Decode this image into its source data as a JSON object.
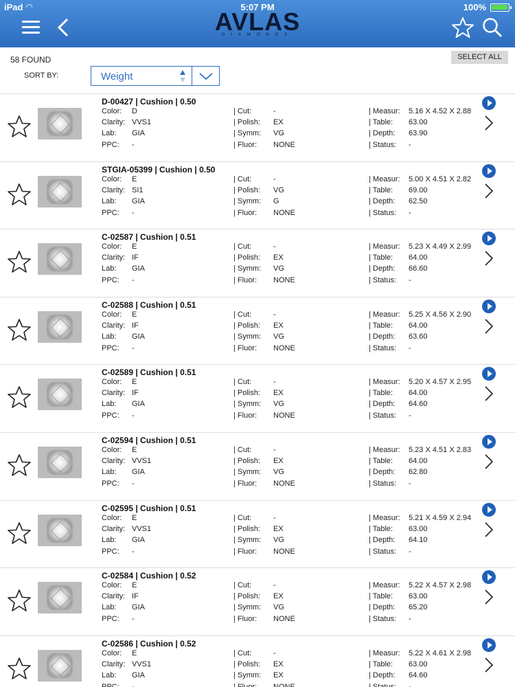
{
  "status": {
    "carrier": "iPad",
    "time": "5:07 PM",
    "battery": "100%",
    "battery_level": 1.0
  },
  "header": {
    "brand": "AVLAS",
    "brand_sub": "DIAMONDS"
  },
  "filters": {
    "found": "58 FOUND",
    "select_all": "SELECT ALL",
    "sort_label": "SORT BY:",
    "sort_value": "Weight"
  },
  "labels": {
    "color": "Color:",
    "clarity": "Clarity:",
    "lab": "Lab:",
    "ppc": "PPC:",
    "cut": "Cut:",
    "polish": "Polish:",
    "symm": "Symm:",
    "fluor": "Fluor:",
    "measur": "Measur:",
    "table": "Table:",
    "depth": "Depth:",
    "status": "Status:"
  },
  "items": [
    {
      "title": "D-00427  |  Cushion  |  0.50",
      "color": "D",
      "clarity": "VVS1",
      "lab": "GIA",
      "ppc": "-",
      "cut": "-",
      "polish": "EX",
      "symm": "VG",
      "fluor": "NONE",
      "measur": "5.16 X 4.52 X 2.88",
      "table": "63.00",
      "depth": "63.90",
      "status": "-"
    },
    {
      "title": "STGIA-05399  |  Cushion  |  0.50",
      "color": "E",
      "clarity": "SI1",
      "lab": "GIA",
      "ppc": "-",
      "cut": "-",
      "polish": "VG",
      "symm": "G",
      "fluor": "NONE",
      "measur": "5.00 X 4.51 X 2.82",
      "table": "69.00",
      "depth": "62.50",
      "status": "-"
    },
    {
      "title": "C-02587  |  Cushion  |  0.51",
      "color": "E",
      "clarity": "IF",
      "lab": "GIA",
      "ppc": "-",
      "cut": "-",
      "polish": "EX",
      "symm": "VG",
      "fluor": "NONE",
      "measur": "5.23 X 4.49 X 2.99",
      "table": "64.00",
      "depth": "66.60",
      "status": "-"
    },
    {
      "title": "C-02588  |  Cushion  |  0.51",
      "color": "E",
      "clarity": "IF",
      "lab": "GIA",
      "ppc": "-",
      "cut": "-",
      "polish": "EX",
      "symm": "VG",
      "fluor": "NONE",
      "measur": "5.25 X 4.56 X 2.90",
      "table": "64.00",
      "depth": "63.60",
      "status": "-"
    },
    {
      "title": "C-02589  |  Cushion  |  0.51",
      "color": "E",
      "clarity": "IF",
      "lab": "GIA",
      "ppc": "-",
      "cut": "-",
      "polish": "EX",
      "symm": "VG",
      "fluor": "NONE",
      "measur": "5.20 X 4.57 X 2.95",
      "table": "64.00",
      "depth": "64.60",
      "status": "-"
    },
    {
      "title": "C-02594  |  Cushion  |  0.51",
      "color": "E",
      "clarity": "VVS1",
      "lab": "GIA",
      "ppc": "-",
      "cut": "-",
      "polish": "EX",
      "symm": "VG",
      "fluor": "NONE",
      "measur": "5.23 X 4.51 X 2.83",
      "table": "64.00",
      "depth": "62.80",
      "status": "-"
    },
    {
      "title": "C-02595  |  Cushion  |  0.51",
      "color": "E",
      "clarity": "VVS1",
      "lab": "GIA",
      "ppc": "-",
      "cut": "-",
      "polish": "EX",
      "symm": "VG",
      "fluor": "NONE",
      "measur": "5.21 X 4.59 X 2.94",
      "table": "63.00",
      "depth": "64.10",
      "status": "-"
    },
    {
      "title": "C-02584  |  Cushion  |  0.52",
      "color": "E",
      "clarity": "IF",
      "lab": "GIA",
      "ppc": "-",
      "cut": "-",
      "polish": "EX",
      "symm": "VG",
      "fluor": "NONE",
      "measur": "5.22 X 4.57 X 2.98",
      "table": "63.00",
      "depth": "65.20",
      "status": "-"
    },
    {
      "title": "C-02586  |  Cushion  |  0.52",
      "color": "E",
      "clarity": "VVS1",
      "lab": "GIA",
      "ppc": "-",
      "cut": "-",
      "polish": "EX",
      "symm": "EX",
      "fluor": "NONE",
      "measur": "5.22 X 4.61 X 2.98",
      "table": "63.00",
      "depth": "64.60",
      "status": "-"
    }
  ]
}
